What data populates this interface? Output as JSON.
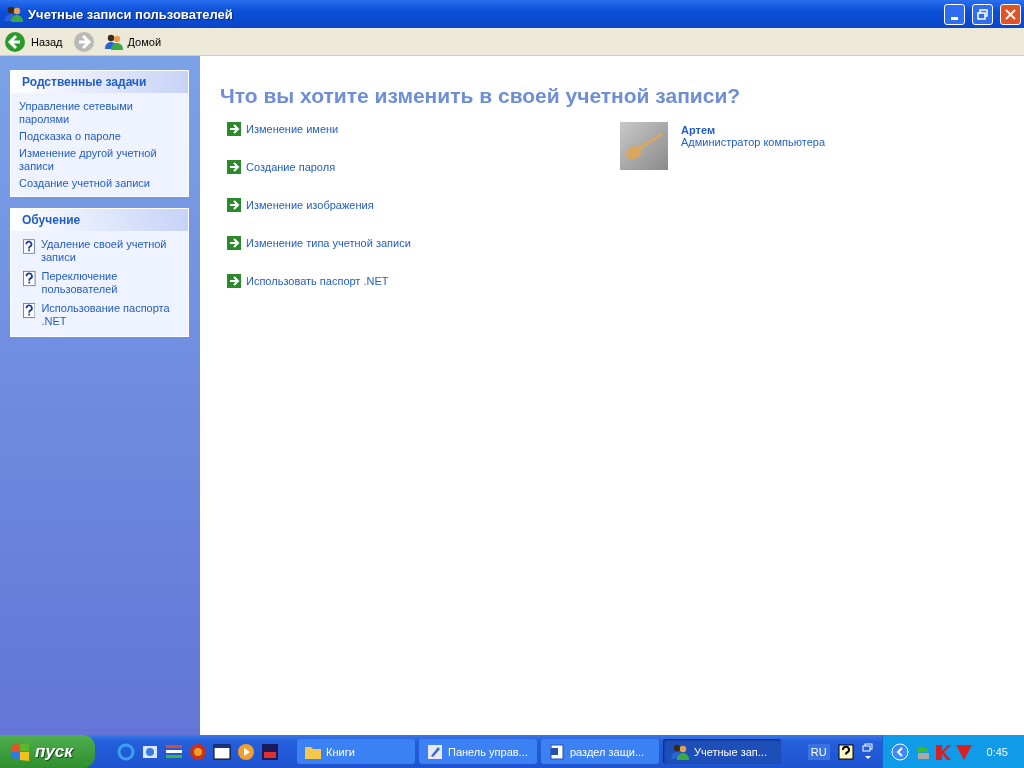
{
  "window": {
    "title": "Учетные записи пользователей"
  },
  "toolbar": [
    {
      "kind": "back",
      "label": "Назад",
      "disabled": false
    },
    {
      "kind": "forward",
      "disabled": true
    },
    {
      "kind": "home",
      "label": "Домой",
      "disabled": false
    }
  ],
  "sidebar": {
    "panels": [
      {
        "title": "Родственные задачи",
        "kind": "links",
        "items": [
          "Управление сетевыми паролями",
          "Подсказка о пароле",
          "Изменение другой учетной записи",
          "Создание учетной записи"
        ]
      },
      {
        "title": "Обучение",
        "kind": "help",
        "items": [
          "Удаление своей учетной записи",
          "Переключение пользователей",
          "Использование паспорта .NET"
        ]
      }
    ]
  },
  "main": {
    "heading": "Что вы хотите изменить в своей учетной записи?",
    "actions": [
      "Изменение имени",
      "Создание пароля",
      "Изменение изображения",
      "Изменение типа учетной записи",
      "Использовать паспорт .NET"
    ],
    "user": {
      "name": "Артем",
      "role": "Администратор компьютера"
    }
  },
  "taskbar": {
    "start_label": "пуск",
    "tasks": [
      {
        "kind": "folder",
        "label": "Книги",
        "selected": false
      },
      {
        "kind": "control-panel",
        "label": "Панель управ...",
        "selected": false
      },
      {
        "kind": "document",
        "label": "раздел защи...",
        "selected": false
      },
      {
        "kind": "users",
        "label": "Учетные зап...",
        "selected": true
      }
    ],
    "language": "RU",
    "clock": "0:45"
  }
}
